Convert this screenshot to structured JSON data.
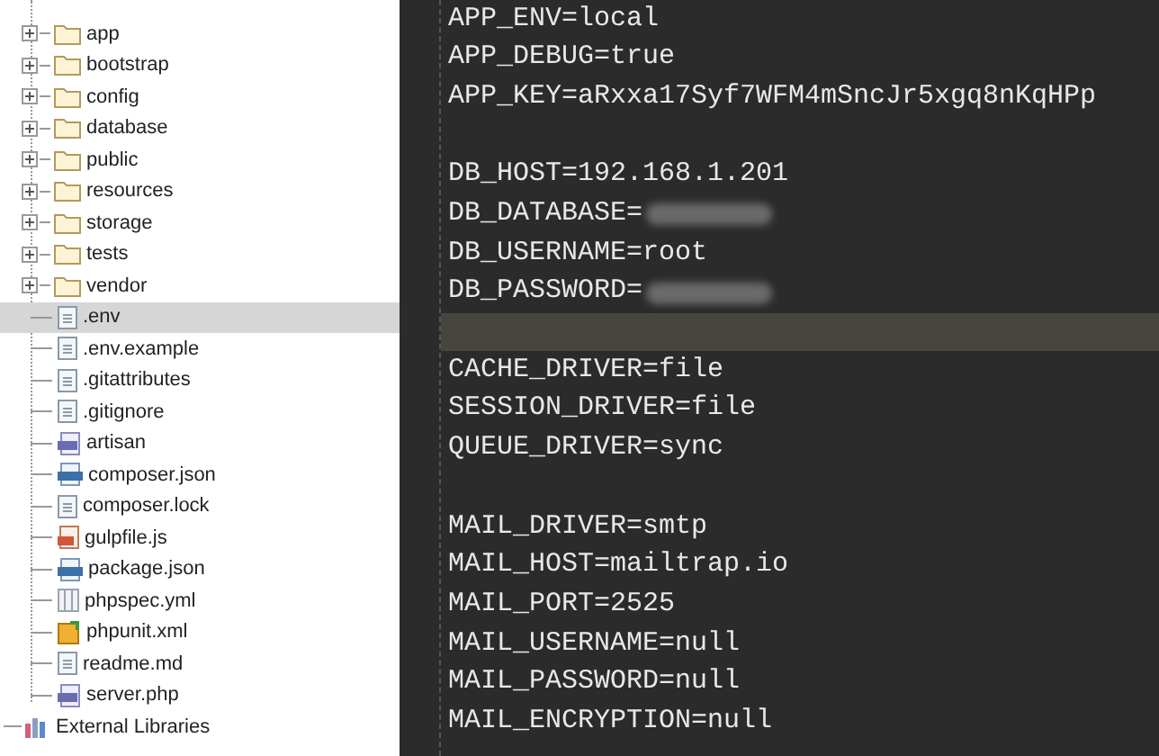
{
  "project_tree": [
    {
      "label": "app",
      "kind": "folder",
      "expanded": false,
      "selected": false
    },
    {
      "label": "bootstrap",
      "kind": "folder",
      "expanded": false,
      "selected": false
    },
    {
      "label": "config",
      "kind": "folder",
      "expanded": false,
      "selected": false
    },
    {
      "label": "database",
      "kind": "folder",
      "expanded": false,
      "selected": false
    },
    {
      "label": "public",
      "kind": "folder",
      "expanded": false,
      "selected": false
    },
    {
      "label": "resources",
      "kind": "folder",
      "expanded": false,
      "selected": false
    },
    {
      "label": "storage",
      "kind": "folder",
      "expanded": false,
      "selected": false
    },
    {
      "label": "tests",
      "kind": "folder",
      "expanded": false,
      "selected": false
    },
    {
      "label": "vendor",
      "kind": "folder",
      "expanded": false,
      "selected": false
    },
    {
      "label": ".env",
      "kind": "text",
      "selected": true
    },
    {
      "label": ".env.example",
      "kind": "text",
      "selected": false
    },
    {
      "label": ".gitattributes",
      "kind": "text",
      "selected": false
    },
    {
      "label": ".gitignore",
      "kind": "text",
      "selected": false
    },
    {
      "label": "artisan",
      "kind": "php",
      "selected": false
    },
    {
      "label": "composer.json",
      "kind": "json",
      "selected": false
    },
    {
      "label": "composer.lock",
      "kind": "text",
      "selected": false
    },
    {
      "label": "gulpfile.js",
      "kind": "js",
      "selected": false
    },
    {
      "label": "package.json",
      "kind": "json",
      "selected": false
    },
    {
      "label": "phpspec.yml",
      "kind": "yml",
      "selected": false
    },
    {
      "label": "phpunit.xml",
      "kind": "xml",
      "selected": false
    },
    {
      "label": "readme.md",
      "kind": "text",
      "selected": false
    },
    {
      "label": "server.php",
      "kind": "php",
      "selected": false
    }
  ],
  "external_libraries": {
    "label": "External Libraries",
    "expanded": false
  },
  "editor_lines": [
    {
      "text": "APP_ENV=local",
      "current": false,
      "redacted": false
    },
    {
      "text": "APP_DEBUG=true",
      "current": false,
      "redacted": false
    },
    {
      "text": "APP_KEY=aRxxa17Syf7WFM4mSncJr5xgq8nKqHPp",
      "current": false,
      "redacted": false
    },
    {
      "current": false,
      "redacted": false
    },
    {
      "text": "DB_HOST=192.168.1.201",
      "current": false,
      "redacted": false
    },
    {
      "text": "DB_DATABASE=",
      "current": false,
      "redacted": true
    },
    {
      "text": "DB_USERNAME=root",
      "current": false,
      "redacted": false
    },
    {
      "text": "DB_PASSWORD=",
      "current": false,
      "redacted": true
    },
    {
      "current": true,
      "redacted": false
    },
    {
      "text": "CACHE_DRIVER=file",
      "current": false,
      "redacted": false
    },
    {
      "text": "SESSION_DRIVER=file",
      "current": false,
      "redacted": false
    },
    {
      "text": "QUEUE_DRIVER=sync",
      "current": false,
      "redacted": false
    },
    {
      "current": false,
      "redacted": false
    },
    {
      "text": "MAIL_DRIVER=smtp",
      "current": false,
      "redacted": false
    },
    {
      "text": "MAIL_HOST=mailtrap.io",
      "current": false,
      "redacted": false
    },
    {
      "text": "MAIL_PORT=2525",
      "current": false,
      "redacted": false
    },
    {
      "text": "MAIL_USERNAME=null",
      "current": false,
      "redacted": false
    },
    {
      "text": "MAIL_PASSWORD=null",
      "current": false,
      "redacted": false
    },
    {
      "text": "MAIL_ENCRYPTION=null",
      "current": false,
      "redacted": false
    }
  ]
}
